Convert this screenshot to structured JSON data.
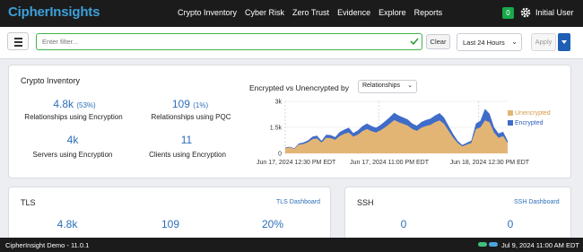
{
  "nav": {
    "logo_part1": "Cipher",
    "logo_part2": "Insights",
    "links": [
      "Crypto Inventory",
      "Cyber Risk",
      "Zero Trust",
      "Evidence",
      "Explore",
      "Reports"
    ],
    "notif_count": "0",
    "user": "Initial User"
  },
  "filter": {
    "placeholder": "Enter filter...",
    "clear_label": "Clear",
    "time_range": "Last 24 Hours",
    "apply_label": "Apply"
  },
  "crypto": {
    "title": "Crypto Inventory",
    "metrics": [
      {
        "value": "4.8k",
        "pct": "(53%)",
        "label": "Relationships using Encryption"
      },
      {
        "value": "109",
        "pct": "(1%)",
        "label": "Relationships using PQC"
      },
      {
        "value": "4k",
        "pct": "",
        "label": "Servers using Encryption"
      },
      {
        "value": "11",
        "pct": "",
        "label": "Clients using Encryption"
      }
    ],
    "chart_title": "Encrypted vs Unencrypted by",
    "chart_group": "Relationships"
  },
  "chart_data": {
    "type": "area",
    "y_ticks": [
      "3k",
      "1.5k",
      "0"
    ],
    "ylim": [
      0,
      3000
    ],
    "x_ticks": [
      "Jun 17, 2024 12:30 PM EDT",
      "Jun 17, 2024 11:00 PM EDT",
      "Jun 18, 2024 12:30 PM EDT"
    ],
    "legend_position": "right",
    "series": [
      {
        "name": "Unencrypted",
        "color": "#e3b574",
        "values": [
          300,
          350,
          260,
          500,
          540,
          640,
          820,
          860,
          620,
          900,
          880,
          780,
          1000,
          1120,
          1200,
          960,
          1080,
          1280,
          1400,
          1280,
          1200,
          1330,
          1500,
          1700,
          1920,
          1800,
          1700,
          1600,
          1400,
          1300,
          1480,
          1580,
          1640,
          1800,
          1900,
          1700,
          1300,
          900,
          600,
          400,
          500,
          600,
          1400,
          1500,
          1900,
          1800,
          1200,
          900,
          1000,
          600
        ]
      },
      {
        "name": "Encrypted",
        "color": "#3f6cc9",
        "values": [
          100,
          100,
          90,
          200,
          250,
          300,
          400,
          460,
          300,
          500,
          500,
          450,
          650,
          720,
          800,
          600,
          700,
          800,
          900,
          850,
          800,
          900,
          1000,
          1100,
          1200,
          1100,
          1050,
          1000,
          900,
          850,
          950,
          1000,
          1050,
          1100,
          1200,
          1050,
          800,
          600,
          350,
          250,
          320,
          380,
          900,
          1100,
          1900,
          1400,
          900,
          700,
          700,
          350
        ]
      }
    ]
  },
  "tls": {
    "title": "TLS",
    "dashboard_link": "TLS Dashboard",
    "values": [
      "4.8k",
      "109",
      "20%"
    ]
  },
  "ssh": {
    "title": "SSH",
    "dashboard_link": "SSH Dashboard",
    "values": [
      "0",
      "0"
    ]
  },
  "footer": {
    "version": "CipherInsight Demo - 11.0.1",
    "datetime": "Jul 9, 2024 11:00 AM EDT"
  }
}
